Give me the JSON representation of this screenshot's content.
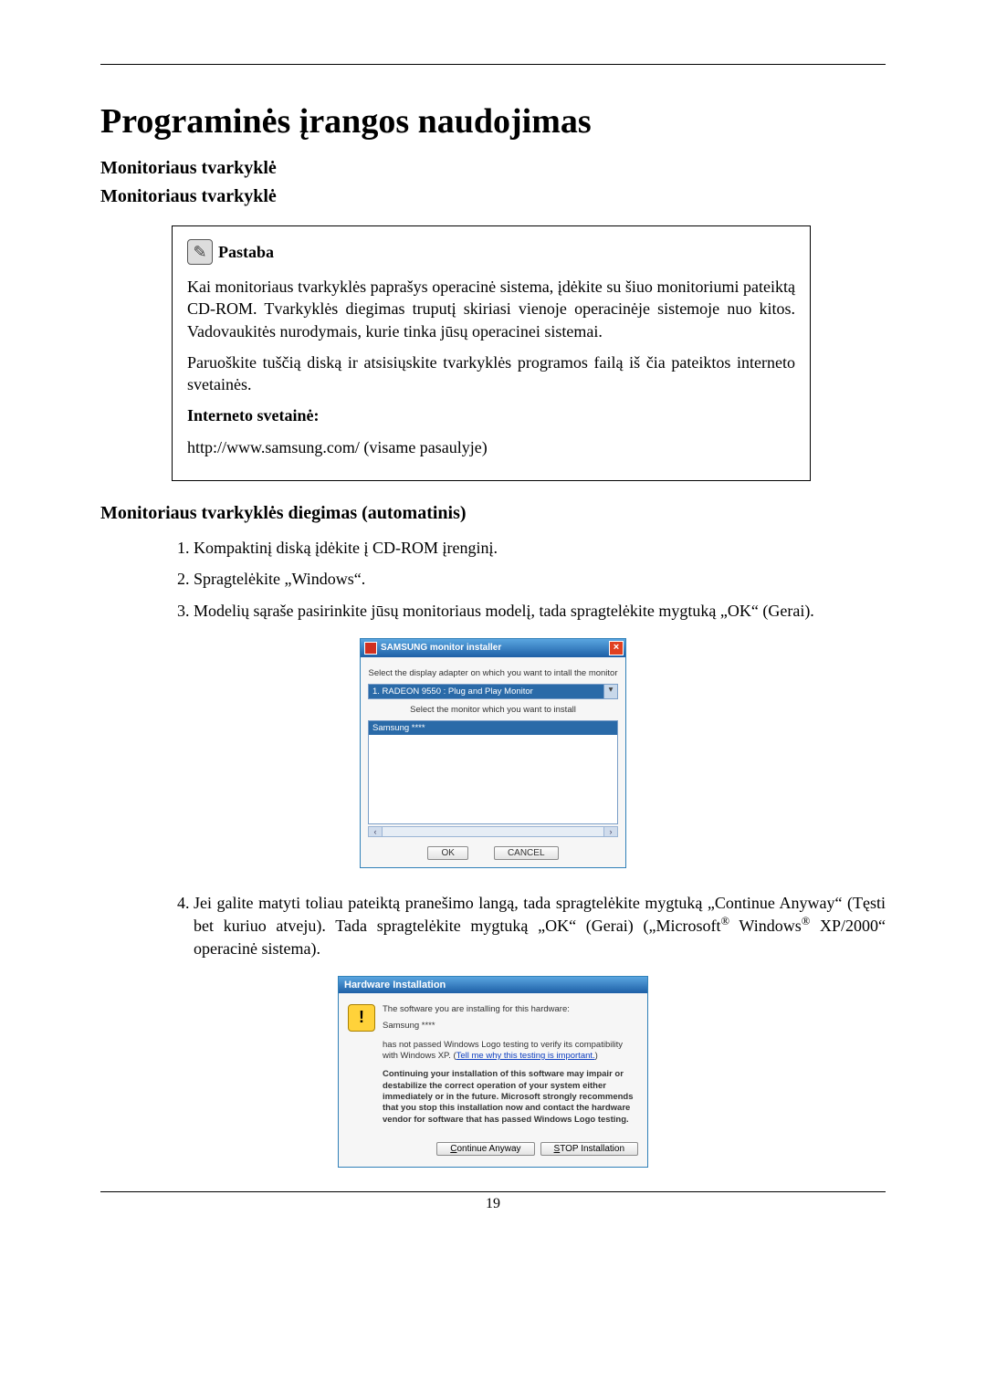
{
  "page": {
    "number": "19",
    "title": "Programinės įrangos naudojimas",
    "h_driver_1": "Monitoriaus tvarkyklė",
    "h_driver_2": "Monitoriaus tvarkyklė",
    "h_install_auto": "Monitoriaus tvarkyklės diegimas (automatinis)"
  },
  "note": {
    "label": "Pastaba",
    "p1": "Kai monitoriaus tvarkyklės paprašys operacinė sistema, įdėkite su šiuo monitoriumi pateiktą CD-ROM. Tvarkyklės diegimas truputį skiriasi vienoje operacinėje sistemoje nuo kitos. Vadovaukitės nurodymais, kurie tinka jūsų operacinei sistemai.",
    "p2": "Paruoškite tuščią diską ir atsisiųskite tvarkyklės programos failą iš čia pateiktos interneto svetainės.",
    "website_label": "Interneto svetainė:",
    "url_line": "http://www.samsung.com/ (visame pasaulyje)"
  },
  "steps": {
    "s1": "Kompaktinį diską įdėkite į CD-ROM įrenginį.",
    "s2": "Spragtelėkite „Windows“.",
    "s3": "Modelių sąraše pasirinkite jūsų monitoriaus modelį, tada spragtelėkite mygtuką „OK“ (Gerai).",
    "s4_a": "Jei galite matyti toliau pateiktą pranešimo langą, tada spragtelėkite mygtuką „Continue Anyway“ (Tęsti bet kuriuo atveju). Tada spragtelėkite mygtuką „OK“ (Gerai) („Microsoft",
    "s4_b": " Windows",
    "s4_c": " XP/2000“ operacinė sistema)."
  },
  "dlg1": {
    "title": "SAMSUNG monitor installer",
    "close": "×",
    "label_adapter": "Select the display adapter on which you want to intall the monitor",
    "combo_value": "1. RADEON 9550 : Plug and Play Monitor",
    "dd": "▾",
    "label_monitor": "Select the monitor which you want to install",
    "list_selected": "Samsung ****",
    "scroll_left": "‹",
    "scroll_right": "›",
    "ok": "OK",
    "cancel": "CANCEL"
  },
  "dlg2": {
    "title": "Hardware Installation",
    "warn_glyph": "!",
    "line1": "The software you are installing for this hardware:",
    "device": "Samsung ****",
    "line2a": "has not passed Windows Logo testing to verify its compatibility with Windows XP. (",
    "link": "Tell me why this testing is important.",
    "line2b": ")",
    "bold": "Continuing your installation of this software may impair or destabilize the correct operation of your system either immediately or in the future. Microsoft strongly recommends that you stop this installation now and contact the hardware vendor for software that has passed Windows Logo testing.",
    "cont_u": "C",
    "cont_rest": "ontinue Anyway",
    "stop_u": "S",
    "stop_rest": "TOP Installation"
  }
}
